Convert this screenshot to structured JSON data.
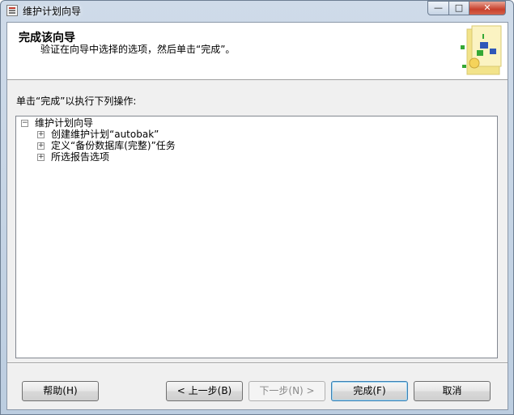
{
  "window": {
    "title": "维护计划向导"
  },
  "titlebar_buttons": {
    "minimize": "—",
    "maximize": "□",
    "close": "✕"
  },
  "header": {
    "title": "完成该向导",
    "subtitle": "验证在向导中选择的选项，然后单击“完成”。"
  },
  "instruction": "单击“完成”以执行下列操作:",
  "tree": {
    "root": {
      "label": "维护计划向导",
      "expander": "−"
    },
    "children": [
      {
        "label": "创建维护计划“autobak”",
        "expander": "+"
      },
      {
        "label": "定义“备份数据库(完整)”任务",
        "expander": "+"
      },
      {
        "label": "所选报告选项",
        "expander": "+"
      }
    ]
  },
  "buttons": {
    "help": "帮助(H)",
    "back": "< 上一步(B)",
    "next": "下一步(N) >",
    "finish": "完成(F)",
    "cancel": "取消"
  },
  "colors": {
    "accent": "#3c7fb1",
    "graphic_yellow": "#f2e38a",
    "graphic_green": "#35a835",
    "graphic_blue": "#2f57b8"
  }
}
